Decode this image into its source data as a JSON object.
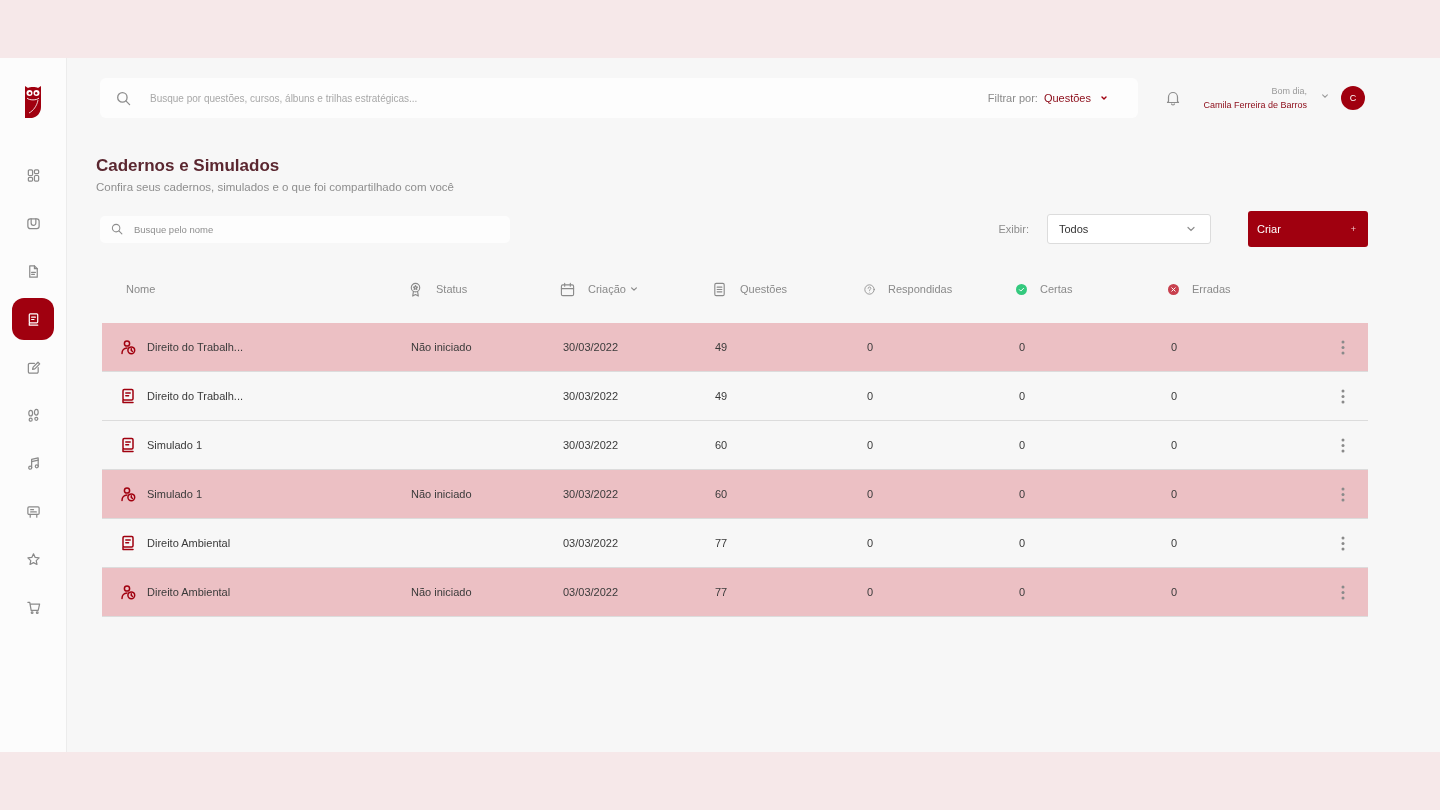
{
  "sidebar": {
    "items": [
      {
        "selected": false
      },
      {
        "selected": false
      },
      {
        "selected": false
      },
      {
        "selected": true
      },
      {
        "selected": false
      },
      {
        "selected": false
      },
      {
        "selected": false
      },
      {
        "selected": false
      },
      {
        "selected": false
      },
      {
        "selected": false
      }
    ]
  },
  "top_bar": {
    "search": {
      "placeholder": "Busque por questões, cursos, álbuns e trilhas estratégicas..."
    },
    "filter": {
      "label": "Filtrar por:",
      "value": "Questões"
    },
    "user": {
      "greeting": "Bom dia,",
      "name": "Camila Ferreira de Barros",
      "initial": "C"
    }
  },
  "page": {
    "title": "Cadernos e Simulados",
    "subtitle": "Confira seus cadernos, simulados e o que foi compartilhado com você"
  },
  "toolbar": {
    "search": {
      "placeholder": "Busque pelo nome"
    },
    "display": {
      "label": "Exibir:",
      "value": "Todos"
    },
    "create_button": {
      "label": "Criar",
      "icon": "+"
    }
  },
  "table": {
    "columns": [
      {
        "label": "Nome",
        "sorted": false
      },
      {
        "label": "Status",
        "sorted": false
      },
      {
        "label": "Criação",
        "sorted": true
      },
      {
        "label": "Questões",
        "sorted": false
      },
      {
        "label": "Respondidas",
        "sorted": false
      },
      {
        "label": "Certas",
        "sorted": false
      },
      {
        "label": "Erradas",
        "sorted": false
      }
    ],
    "rows": [
      {
        "kind": "simulado",
        "name": "Direito do Trabalh...",
        "status": "Não iniciado",
        "created": "30/03/2022",
        "questions": "49",
        "answered": "0",
        "correct": "0",
        "wrong": "0"
      },
      {
        "kind": "caderno",
        "name": "Direito do Trabalh...",
        "created": "30/03/2022",
        "questions": "49",
        "answered": "0",
        "correct": "0",
        "wrong": "0"
      },
      {
        "kind": "caderno",
        "name": "Simulado 1",
        "created": "30/03/2022",
        "questions": "60",
        "answered": "0",
        "correct": "0",
        "wrong": "0"
      },
      {
        "kind": "simulado",
        "name": "Simulado 1",
        "status": "Não iniciado",
        "created": "30/03/2022",
        "questions": "60",
        "answered": "0",
        "correct": "0",
        "wrong": "0"
      },
      {
        "kind": "caderno",
        "name": "Direito Ambiental",
        "created": "03/03/2022",
        "questions": "77",
        "answered": "0",
        "correct": "0",
        "wrong": "0"
      },
      {
        "kind": "simulado",
        "name": "Direito Ambiental",
        "status": "Não iniciado",
        "created": "03/03/2022",
        "questions": "77",
        "answered": "0",
        "correct": "0",
        "wrong": "0"
      }
    ]
  }
}
